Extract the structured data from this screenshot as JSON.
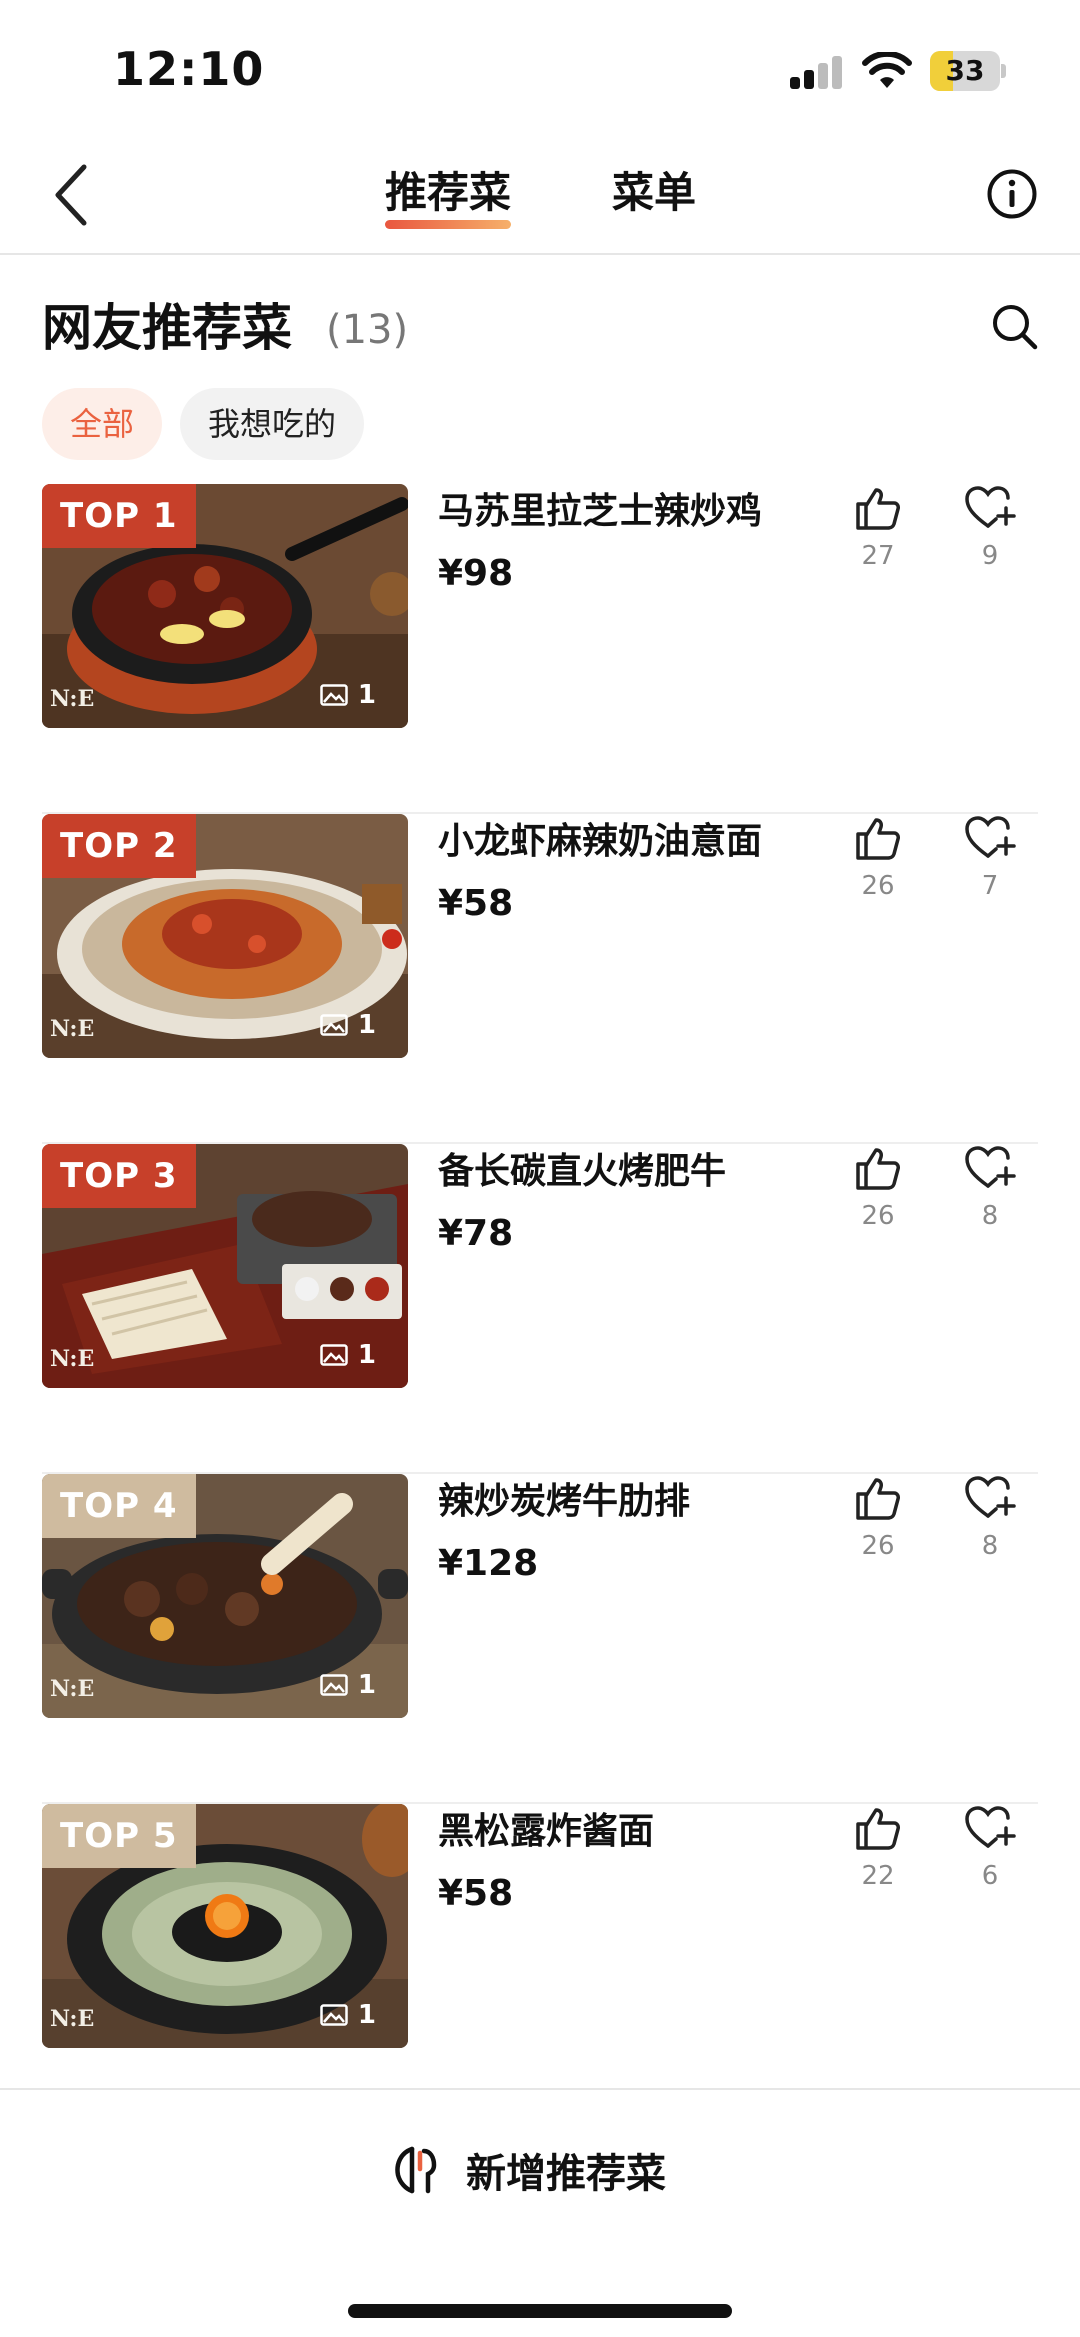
{
  "status_bar": {
    "time": "12:10",
    "battery_level": "33",
    "battery_fraction": 0.33,
    "icons": [
      "cellular-signal-icon",
      "wifi-icon",
      "battery-icon"
    ]
  },
  "nav": {
    "tabs": [
      {
        "label": "推荐菜",
        "active": true
      },
      {
        "label": "菜单",
        "active": false
      }
    ],
    "icons": [
      "back-chevron-icon",
      "info-icon"
    ]
  },
  "section": {
    "title": "网友推荐菜",
    "count": "(13)",
    "chips": [
      {
        "label": "全部",
        "active": true
      },
      {
        "label": "我想吃的",
        "active": false
      }
    ]
  },
  "dishes": [
    {
      "rank": "TOP 1",
      "name": "马苏里拉芝士辣炒鸡",
      "price": "¥98",
      "likes": "27",
      "favorites": "9",
      "photos": "1"
    },
    {
      "rank": "TOP 2",
      "name": "小龙虾麻辣奶油意面",
      "price": "¥58",
      "likes": "26",
      "favorites": "7",
      "photos": "1"
    },
    {
      "rank": "TOP 3",
      "name": "备长碳直火烤肥牛",
      "price": "¥78",
      "likes": "26",
      "favorites": "8",
      "photos": "1"
    },
    {
      "rank": "TOP 4",
      "name": "辣炒炭烤牛肋排",
      "price": "¥128",
      "likes": "26",
      "favorites": "8",
      "photos": "1"
    },
    {
      "rank": "TOP 5",
      "name": "黑松露炸酱面",
      "price": "¥58",
      "likes": "22",
      "favorites": "6",
      "photos": "1"
    }
  ],
  "bottom_bar": {
    "add_label": "新增推荐菜"
  },
  "colors": {
    "accent": "#ea6240",
    "badge_top": "#c7402a",
    "badge_other": "#cfbb9f",
    "chip_active_bg": "#fdeee8"
  }
}
